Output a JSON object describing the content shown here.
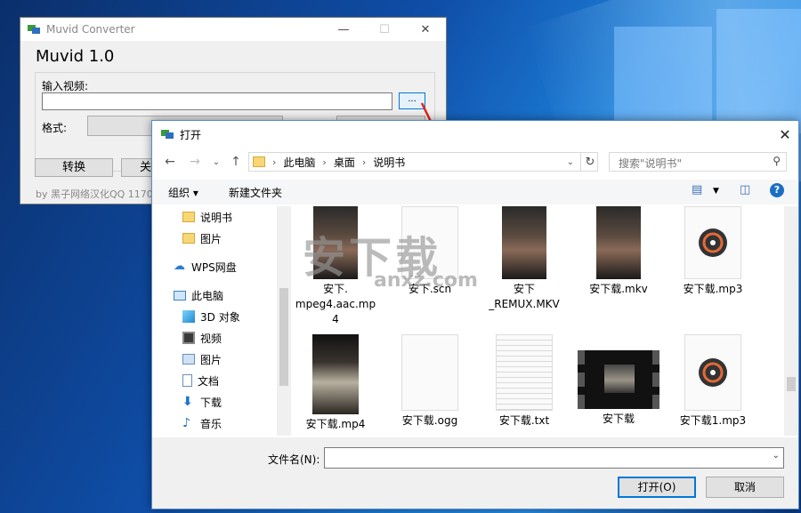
{
  "muvid": {
    "title": "Muvid Converter",
    "heading": "Muvid 1.0",
    "input_label": "输入视频:",
    "browse_label": "...",
    "format_label": "格式:",
    "convert_label": "转换",
    "close_label": "关",
    "footer": "by 黑子网络汉化QQ 1170"
  },
  "dialog": {
    "title": "打开",
    "breadcrumb": [
      "此电脑",
      "桌面",
      "说明书"
    ],
    "search_placeholder": "搜索\"说明书\"",
    "organize_label": "组织 ▾",
    "new_folder_label": "新建文件夹",
    "sidebar": [
      {
        "label": "说明书",
        "icon": "folder-icon"
      },
      {
        "label": "图片",
        "icon": "folder-icon"
      },
      {
        "label": "WPS网盘",
        "icon": "cloud-icon"
      },
      {
        "label": "此电脑",
        "icon": "computer-icon"
      },
      {
        "label": "3D 对象",
        "icon": "cube-icon"
      },
      {
        "label": "视频",
        "icon": "video-icon"
      },
      {
        "label": "图片",
        "icon": "picture-icon"
      },
      {
        "label": "文档",
        "icon": "document-icon"
      },
      {
        "label": "下载",
        "icon": "download-icon"
      },
      {
        "label": "音乐",
        "icon": "music-icon"
      }
    ],
    "files": [
      {
        "name": "安下.\nmpeg4.aac.mp\n4",
        "kind": "video"
      },
      {
        "name": "安下.scn",
        "kind": "blank"
      },
      {
        "name": "安下\n_REMUX.MKV",
        "kind": "video"
      },
      {
        "name": "安下载.mkv",
        "kind": "video"
      },
      {
        "name": "安下载.mp3",
        "kind": "audio"
      },
      {
        "name": "安下载.mp4",
        "kind": "video2"
      },
      {
        "name": "安下载.ogg",
        "kind": "blank"
      },
      {
        "name": "安下载.txt",
        "kind": "text"
      },
      {
        "name": "安下载",
        "kind": "filmstrip"
      },
      {
        "name": "安下载1.mp3",
        "kind": "audio"
      }
    ],
    "filename_label": "文件名(N):",
    "filename_value": "",
    "open_label": "打开(O)",
    "cancel_label": "取消"
  },
  "watermark": {
    "text": "安下载",
    "sub": "anxz.com"
  },
  "colors": {
    "accent": "#0078d7",
    "arrow": "#e0251b"
  }
}
